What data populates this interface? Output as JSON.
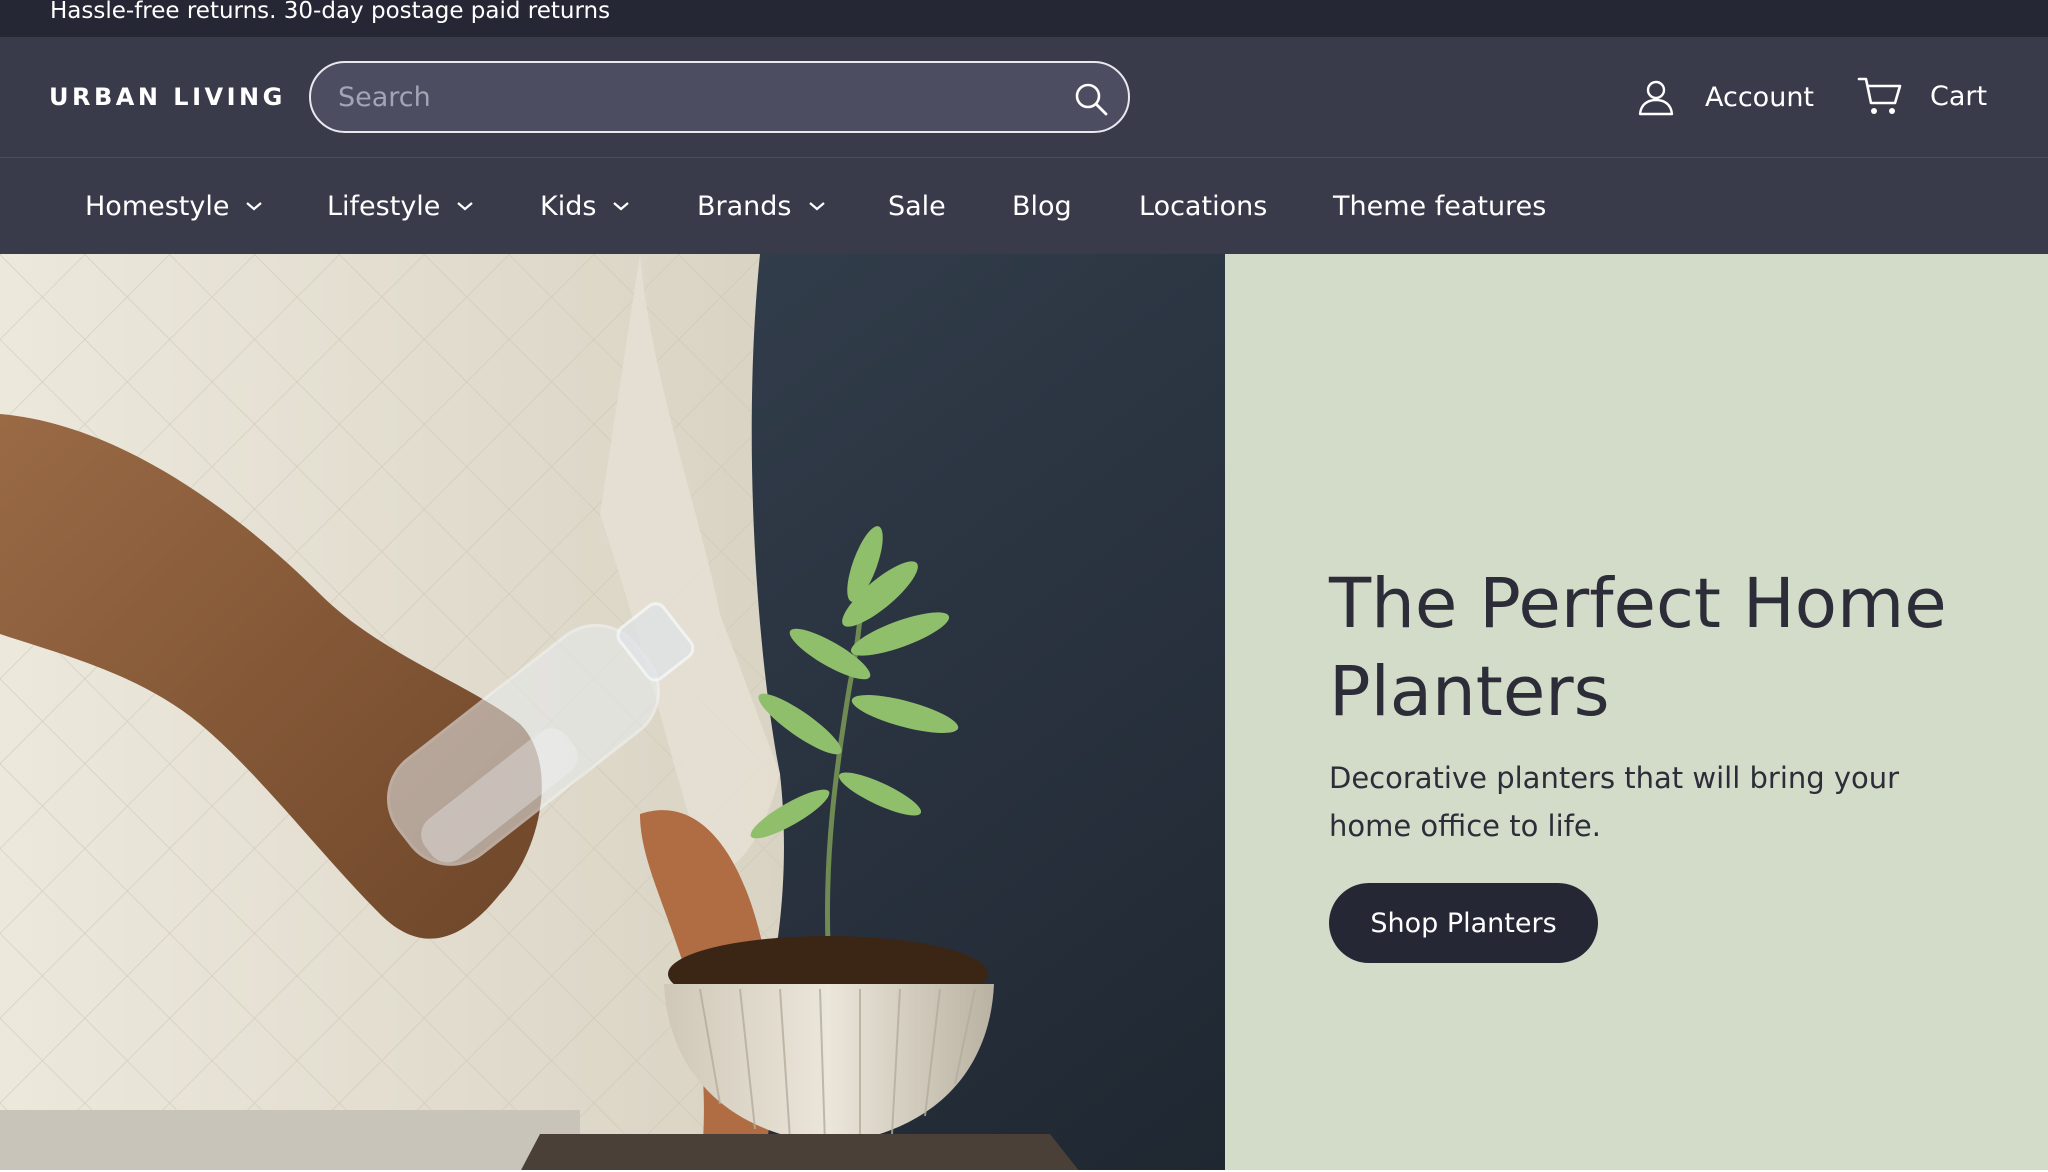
{
  "announcement": {
    "text": "Hassle-free returns. 30-day postage paid returns"
  },
  "header": {
    "logo": "URBAN LIVING",
    "search": {
      "placeholder": "Search",
      "value": ""
    },
    "account_label": "Account",
    "cart_label": "Cart"
  },
  "nav": {
    "items": [
      {
        "label": "Homestyle",
        "dropdown": true
      },
      {
        "label": "Lifestyle",
        "dropdown": true
      },
      {
        "label": "Kids",
        "dropdown": true
      },
      {
        "label": "Brands",
        "dropdown": true
      },
      {
        "label": "Sale",
        "dropdown": false
      },
      {
        "label": "Blog",
        "dropdown": false
      },
      {
        "label": "Locations",
        "dropdown": false
      },
      {
        "label": "Theme features",
        "dropdown": false
      }
    ]
  },
  "hero": {
    "title": "The Perfect Home Planters",
    "subtitle": "Decorative planters that will bring your home office to life.",
    "button_label": "Shop Planters"
  },
  "colors": {
    "header_bg": "#393a4a",
    "announcement_bg": "#262735",
    "hero_panel_bg": "#d3dbc9",
    "button_bg": "#262735",
    "text_dark": "#2c2d38"
  },
  "icons": {
    "search": "search-icon",
    "account": "user-icon",
    "cart": "cart-icon",
    "dropdown": "chevron-down-icon"
  }
}
